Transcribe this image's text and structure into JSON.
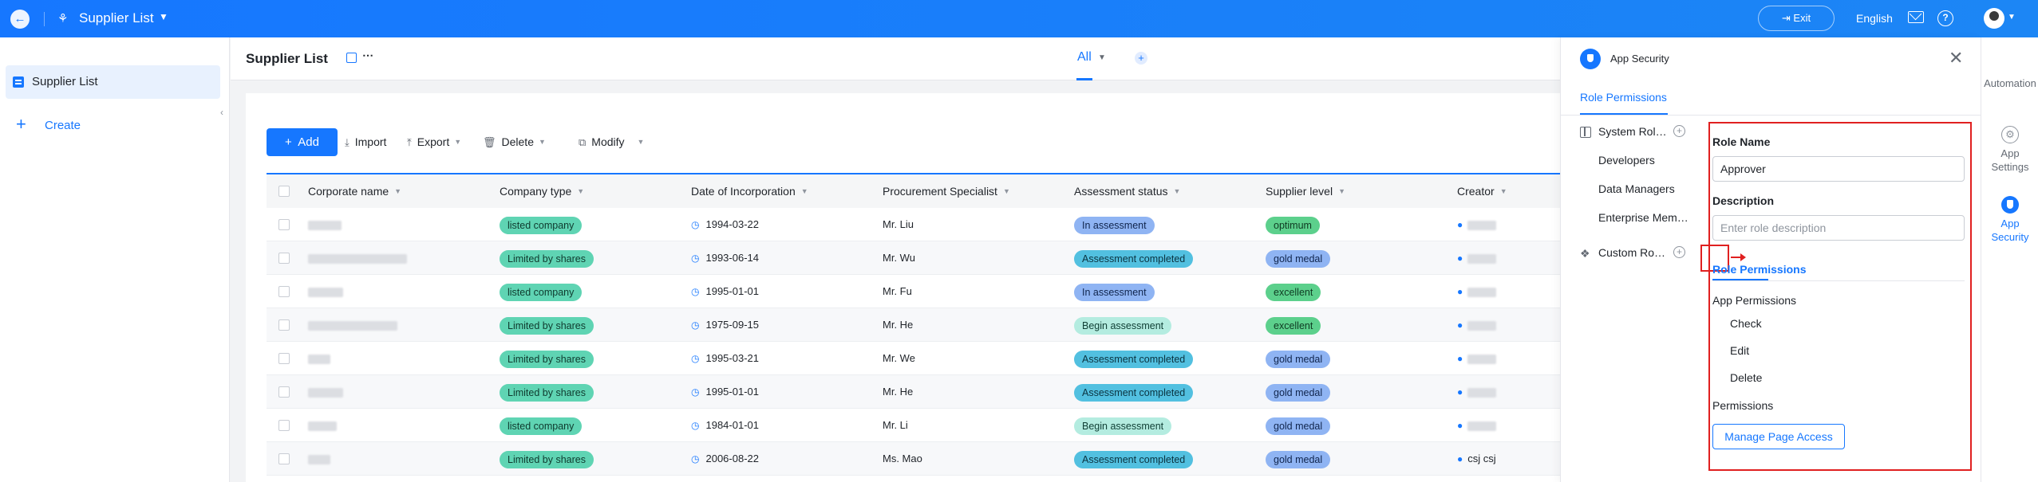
{
  "topbar": {
    "back_icon": "arrow-left-icon",
    "app_icon": "supplier-icon",
    "app_title": "Supplier List",
    "exit_label": "Exit",
    "language": "English",
    "icons": [
      "mail-icon",
      "help-icon",
      "avatar"
    ]
  },
  "sidebar": {
    "items": [
      {
        "label": "Supplier List",
        "icon": "list-icon"
      }
    ],
    "create_label": "Create"
  },
  "header": {
    "title": "Supplier List",
    "view_tab": "All"
  },
  "toolbar": {
    "add_label": "Add",
    "import_label": "Import",
    "export_label": "Export",
    "delete_label": "Delete",
    "modify_label": "Modify"
  },
  "table": {
    "columns": [
      "Corporate name",
      "Company type",
      "Date of Incorporation",
      "Procurement Specialist",
      "Assessment status",
      "Supplier level",
      "Creator"
    ],
    "rows": [
      {
        "company_type": "listed company",
        "date": "1994-03-22",
        "specialist": "Mr. Liu",
        "status": "In assessment",
        "level": "optimum",
        "creator": ""
      },
      {
        "company_type": "Limited by shares",
        "date": "1993-06-14",
        "specialist": "Mr. Wu",
        "status": "Assessment completed",
        "level": "gold medal",
        "creator": ""
      },
      {
        "company_type": "listed company",
        "date": "1995-01-01",
        "specialist": "Mr. Fu",
        "status": "In assessment",
        "level": "excellent",
        "creator": ""
      },
      {
        "company_type": "Limited by shares",
        "date": "1975-09-15",
        "specialist": "Mr. He",
        "status": "Begin assessment",
        "level": "excellent",
        "creator": ""
      },
      {
        "company_type": "Limited by shares",
        "date": "1995-03-21",
        "specialist": "Mr. We",
        "status": "Assessment completed",
        "level": "gold medal",
        "creator": ""
      },
      {
        "company_type": "Limited by shares",
        "date": "1995-01-01",
        "specialist": "Mr. He",
        "status": "Assessment completed",
        "level": "gold medal",
        "creator": ""
      },
      {
        "company_type": "listed company",
        "date": "1984-01-01",
        "specialist": "Mr. Li",
        "status": "Begin assessment",
        "level": "gold medal",
        "creator": ""
      },
      {
        "company_type": "Limited by shares",
        "date": "2006-08-22",
        "specialist": "Ms. Mao",
        "status": "Assessment completed",
        "level": "gold medal",
        "creator": "csj csj"
      }
    ]
  },
  "panel": {
    "title": "App Security",
    "tab": "Role Permissions",
    "roles": {
      "system_group": "System Rol…",
      "system_items": [
        "Developers",
        "Data Managers",
        "Enterprise Mem…"
      ],
      "custom_group": "Custom Ro…"
    },
    "form": {
      "role_name_label": "Role Name",
      "role_name_value": "Approver",
      "description_label": "Description",
      "description_placeholder": "Enter role description",
      "permissions_tab": "Role Permissions",
      "app_permissions_label": "App Permissions",
      "checks": [
        "Check",
        "Edit",
        "Delete"
      ],
      "permissions_label": "Permissions",
      "manage_button": "Manage Page Access"
    }
  },
  "rail": {
    "items": [
      {
        "label": "Automation"
      },
      {
        "label": "App Settings"
      },
      {
        "label": "App Security"
      }
    ]
  },
  "colors": {
    "accent": "#1677ff",
    "highlight": "#e02020"
  }
}
